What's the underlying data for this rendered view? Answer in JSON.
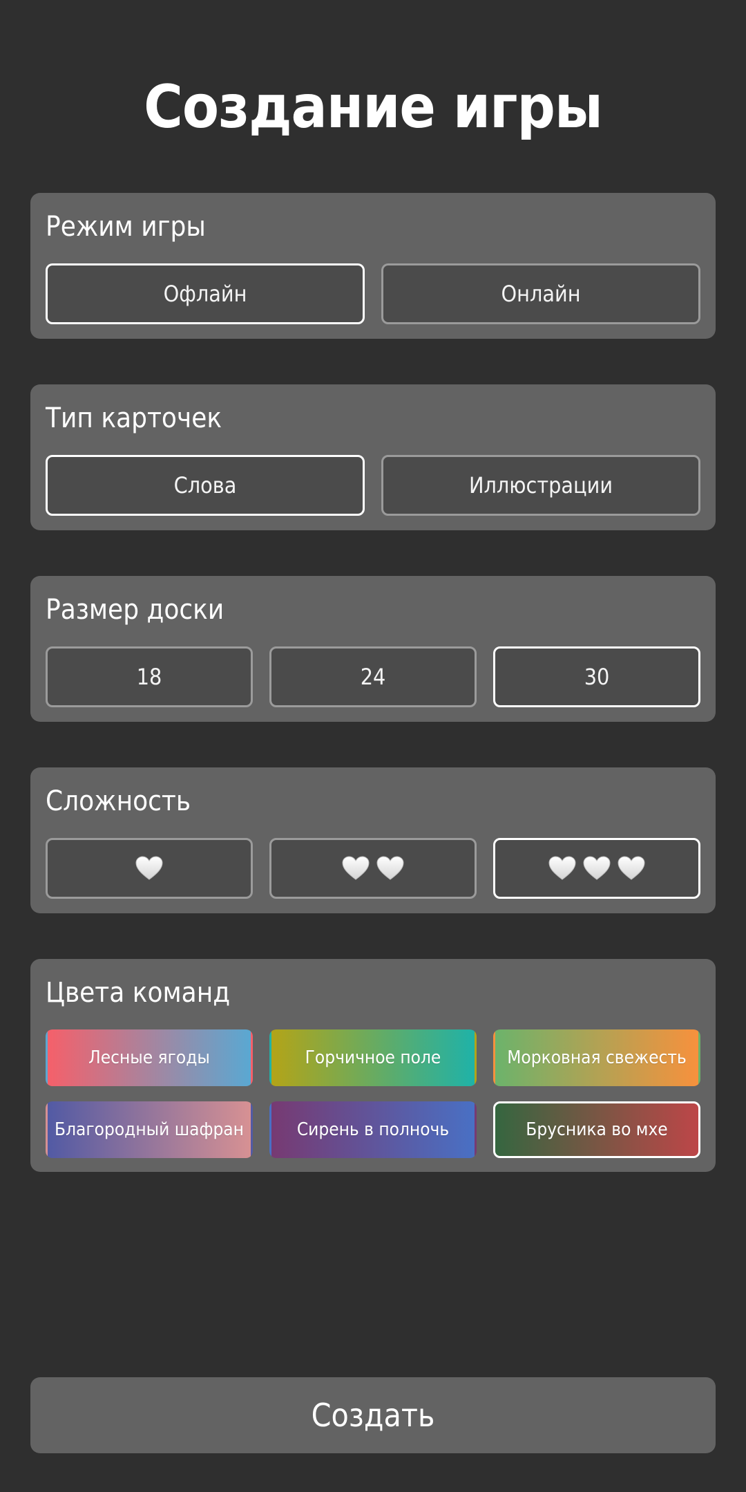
{
  "title": "Создание игры",
  "game_mode": {
    "label": "Режим игры",
    "options": [
      "Офлайн",
      "Онлайн"
    ],
    "selected": "Офлайн"
  },
  "card_type": {
    "label": "Тип карточек",
    "options": [
      "Слова",
      "Иллюстрации"
    ],
    "selected": "Слова"
  },
  "board_size": {
    "label": "Размер доски",
    "options": [
      "18",
      "24",
      "30"
    ],
    "selected": "30"
  },
  "difficulty": {
    "label": "Сложность",
    "levels": [
      1,
      2,
      3
    ],
    "selected_level": 3,
    "icon": "heart-icon"
  },
  "team_colors": {
    "label": "Цвета команд",
    "options": [
      {
        "name": "Лесные ягоды",
        "colors": [
          "#f5606a",
          "#5aa8d2"
        ]
      },
      {
        "name": "Горчичное поле",
        "colors": [
          "#b3a418",
          "#1fb2a8"
        ]
      },
      {
        "name": "Морковная свежесть",
        "colors": [
          "#6cb36b",
          "#f7913d"
        ]
      },
      {
        "name": "Благородный шафран",
        "colors": [
          "#525aa4",
          "#d79193"
        ]
      },
      {
        "name": "Сирень в полночь",
        "colors": [
          "#773a72",
          "#4970c4"
        ]
      },
      {
        "name": "Брусника во мхе",
        "colors": [
          "#356640",
          "#bd4648"
        ]
      }
    ],
    "selected": "Брусника во мхе"
  },
  "create_button": "Создать"
}
